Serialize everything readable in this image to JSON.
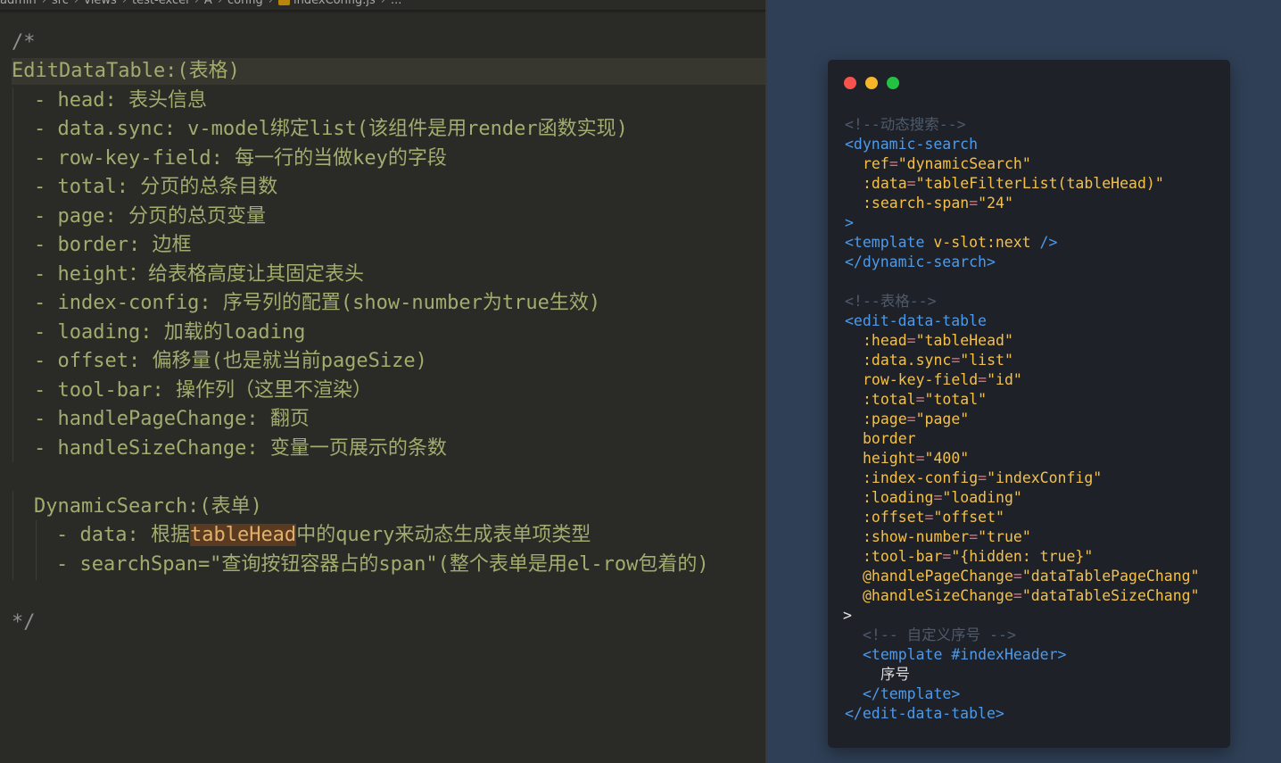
{
  "editor": {
    "breadcrumb": {
      "parts": [
        "admin",
        "src",
        "views",
        "test-excel",
        "A",
        "config"
      ],
      "file": "indexConfig.js",
      "ellipsis": "..."
    },
    "lines": [
      {
        "text": "/*"
      },
      {
        "text": "EditDataTable:(表格)"
      },
      {
        "text": "- head: 表头信息"
      },
      {
        "text": "- data.sync: v-model绑定list(该组件是用render函数实现)"
      },
      {
        "text": "- row-key-field: 每一行的当做key的字段"
      },
      {
        "text": "- total: 分页的总条目数"
      },
      {
        "text": "- page: 分页的总页变量"
      },
      {
        "text": "- border: 边框"
      },
      {
        "text": "- height：给表格高度让其固定表头"
      },
      {
        "text": "- index-config: 序号列的配置(show-number为true生效)"
      },
      {
        "text": "- loading: 加载的loading"
      },
      {
        "text": "- offset: 偏移量(也是就当前pageSize)"
      },
      {
        "text": "- tool-bar: 操作列（这里不渲染）"
      },
      {
        "text": "- handlePageChange: 翻页"
      },
      {
        "text": "- handleSizeChange: 变量一页展示的条数"
      },
      {
        "text": "DynamicSearch:(表单)"
      },
      {
        "text_before": "- data: 根据",
        "highlight": "tableHead",
        "text_after": "中的query来动态生成表单项类型"
      },
      {
        "text": "- searchSpan=\"查询按钮容器占的span\"(整个表单是用el-row包着的)"
      },
      {
        "text": "*/"
      }
    ]
  },
  "code": {
    "comment_search": "<!--动态搜索-->",
    "tag_dynamic_open": "<dynamic-search",
    "attr_ref": "ref",
    "val_ref": "\"dynamicSearch\"",
    "attr_data": ":data",
    "val_data": "\"tableFilterList(tableHead)\"",
    "attr_span": ":search-span",
    "val_span": "\"24\"",
    "gt": ">",
    "tpl_open": "<template",
    "tpl_slot": " v-slot:next",
    "tpl_selfclose": " />",
    "tag_dynamic_close": "</dynamic-search>",
    "comment_table": "<!--表格-->",
    "tag_edit_open": "<edit-data-table",
    "attrs": [
      {
        "name": ":head",
        "value": "\"tableHead\""
      },
      {
        "name": ":data.sync",
        "value": "\"list\""
      },
      {
        "name": "row-key-field",
        "value": "\"id\""
      },
      {
        "name": ":total",
        "value": "\"total\""
      },
      {
        "name": ":page",
        "value": "\"page\""
      },
      {
        "name": "border",
        "value": ""
      },
      {
        "name": "height",
        "value": "\"400\""
      },
      {
        "name": ":index-config",
        "value": "\"indexConfig\""
      },
      {
        "name": ":loading",
        "value": "\"loading\""
      },
      {
        "name": ":offset",
        "value": "\"offset\""
      },
      {
        "name": ":show-number",
        "value": "\"true\""
      },
      {
        "name": ":tool-bar",
        "value": "\"{hidden: true}\""
      },
      {
        "name": "@handlePageChange",
        "value": "\"dataTablePageChang\""
      },
      {
        "name": "@handleSizeChange",
        "value": "\"dataTableSizeChang\""
      }
    ],
    "comment_index": "<!-- 自定义序号 -->",
    "tpl_index_open": "<template #indexHeader>",
    "index_text": "序号",
    "tpl_close": "</template>",
    "tag_edit_close": "</edit-data-table>"
  },
  "colors": {
    "editor_bg": "#2a2a27",
    "panel_bg": "#2f3f55",
    "code_bg": "#1e2128",
    "tag": "#4f9ae8",
    "attr": "#f3c14b",
    "string": "#b5df73"
  }
}
